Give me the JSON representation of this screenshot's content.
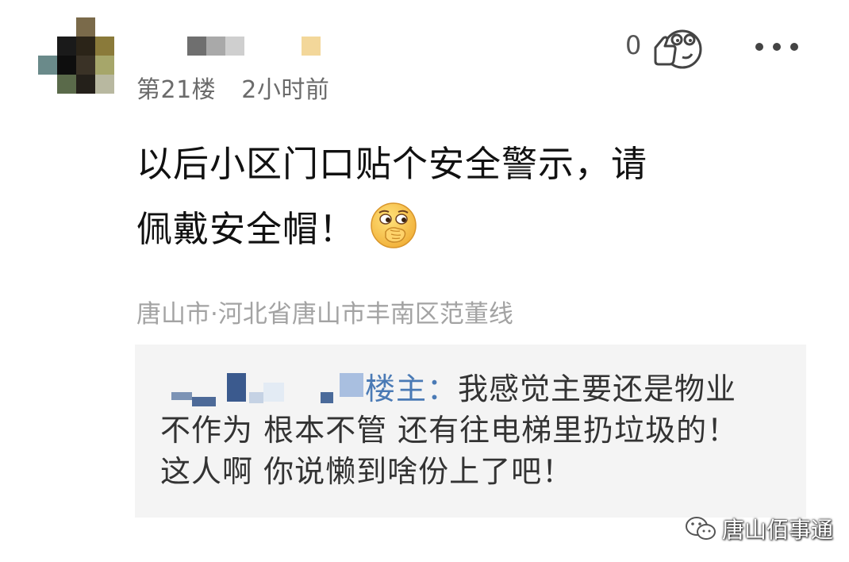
{
  "post": {
    "floor": "第21楼",
    "time": "2小时前",
    "like_count": "0",
    "content_line1": "以后小区门口贴个安全警示，请",
    "content_line2": "佩戴安全帽！",
    "location": "唐山市·河北省唐山市丰南区范董线"
  },
  "reply": {
    "author": "楼主：",
    "text_line1": "我感觉主要还是物业",
    "text_line2": "不作为 根本不管 还有往电梯里扔垃圾的！",
    "text_line3": "这人啊 你说懒到啥份上了吧！"
  },
  "watermark": {
    "text": "唐山佰事通"
  },
  "icons": {
    "like": "thumb-emoji-icon",
    "more": "more-dots-icon",
    "emoji": "cover-mouth-emoji-icon",
    "watermark": "wechat-logo-icon"
  },
  "colors": {
    "reply_author": "#4a7ab5",
    "meta_text": "#6b6b6b",
    "location_text": "#a3a3a3",
    "reply_bg": "#f4f4f4"
  }
}
